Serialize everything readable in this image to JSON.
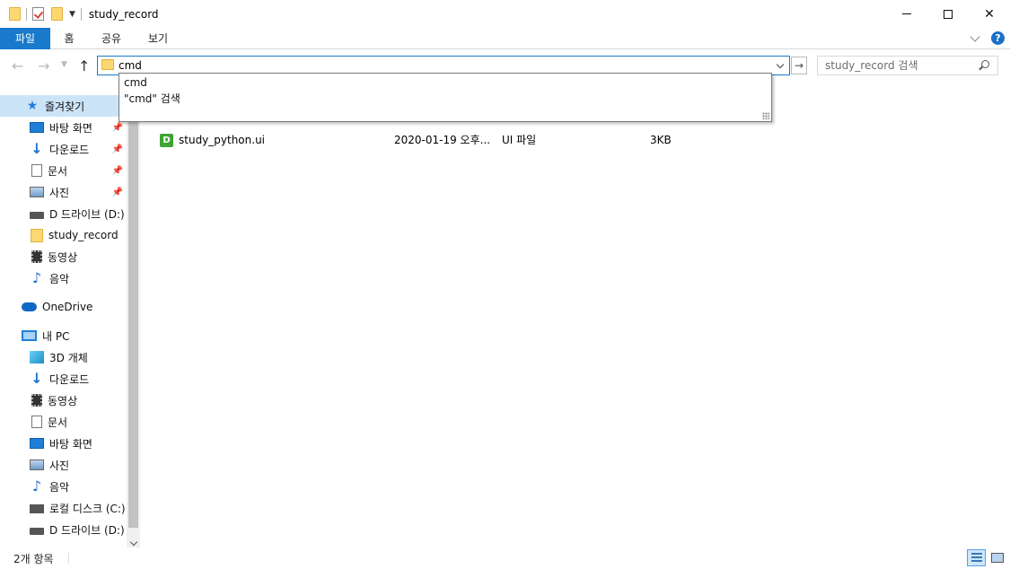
{
  "window": {
    "title": "study_record"
  },
  "ribbon": {
    "tabs": [
      "파일",
      "홈",
      "공유",
      "보기"
    ],
    "help": "?"
  },
  "nav": {
    "back_icon": "arrow-left-icon",
    "forward_icon": "arrow-right-icon",
    "up_icon": "arrow-up-icon",
    "address_value": "cmd",
    "search_placeholder": "study_record 검색"
  },
  "suggestions": [
    "cmd",
    "\"cmd\" 검색"
  ],
  "sidebar": {
    "items": [
      {
        "label": "즐겨찾기",
        "icon": "star-icon"
      },
      {
        "label": "바탕 화면",
        "icon": "desktop-icon",
        "pinned": true
      },
      {
        "label": "다운로드",
        "icon": "download-icon",
        "pinned": true
      },
      {
        "label": "문서",
        "icon": "document-icon",
        "pinned": true
      },
      {
        "label": "사진",
        "icon": "picture-icon",
        "pinned": true
      },
      {
        "label": "D 드라이브 (D:)",
        "icon": "drive-icon"
      },
      {
        "label": "study_record",
        "icon": "folder-icon"
      },
      {
        "label": "동영상",
        "icon": "video-icon"
      },
      {
        "label": "음악",
        "icon": "music-icon"
      },
      {
        "label": "OneDrive",
        "icon": "cloud-icon"
      },
      {
        "label": "내 PC",
        "icon": "pc-icon"
      },
      {
        "label": "3D 개체",
        "icon": "cube-icon"
      },
      {
        "label": "다운로드",
        "icon": "download-icon"
      },
      {
        "label": "동영상",
        "icon": "video-icon"
      },
      {
        "label": "문서",
        "icon": "document-icon"
      },
      {
        "label": "바탕 화면",
        "icon": "desktop-icon"
      },
      {
        "label": "사진",
        "icon": "picture-icon"
      },
      {
        "label": "음악",
        "icon": "music-icon"
      },
      {
        "label": "로컬 디스크 (C:)",
        "icon": "local-disk-icon"
      },
      {
        "label": "D 드라이브 (D:)",
        "icon": "drive-icon"
      }
    ]
  },
  "files": [
    {
      "name": "study_python.ui",
      "date": "2020-01-19 오후...",
      "type": "UI 파일",
      "size": "3KB",
      "icon_letter": "D"
    }
  ],
  "status": {
    "count": "2개 항목"
  }
}
